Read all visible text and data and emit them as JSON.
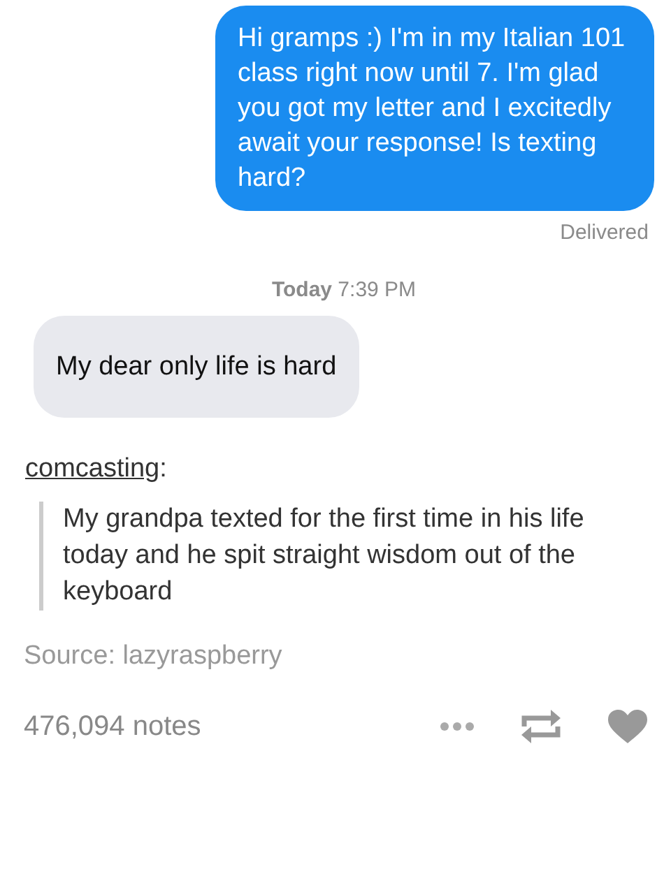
{
  "conversation": [
    {
      "kind": "sent",
      "text": "Hi gramps :) I'm in my Italian 101 class right now until 7. I'm glad you got my letter and I excitedly await your response! Is texting hard?"
    },
    {
      "kind": "status",
      "text": "Delivered"
    },
    {
      "kind": "timestamp",
      "text": "**Today** 7:39 PM"
    },
    {
      "kind": "received",
      "text": "My dear only life is hard"
    }
  ],
  "post": {
    "author": "comcasting",
    "author_suffix": ":",
    "quote": "My grandpa texted for the first time in his life today and he spit straight wisdom out of the keyboard",
    "source": "Source: lazyraspberry",
    "notes": "476,094 notes"
  }
}
